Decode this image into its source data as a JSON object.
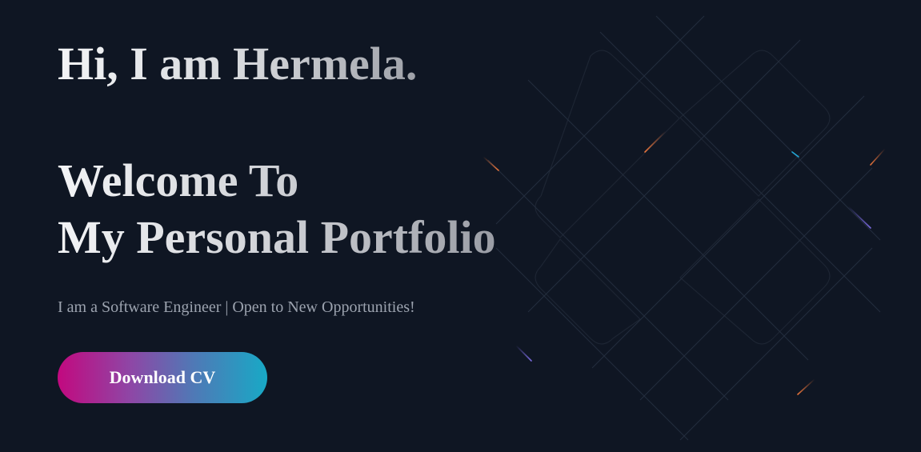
{
  "hero": {
    "greeting": "Hi, I am Hermela.",
    "welcome_line1": "Welcome To",
    "welcome_line2": "My Personal Portfolio",
    "tagline": "I am a Software Engineer | Open to New Opportunities!",
    "cta_label": "Download CV"
  },
  "colors": {
    "background": "#0f1623",
    "text_muted": "#9ca3af",
    "button_gradient": [
      "#c2097f",
      "#8e47a6",
      "#4f79b6",
      "#18a9c6"
    ],
    "meteor_orange": "#e8743b",
    "meteor_blue": "#22a6d6",
    "meteor_purple": "#7b6be0"
  },
  "background_decoration": "grid-diamond-pattern"
}
